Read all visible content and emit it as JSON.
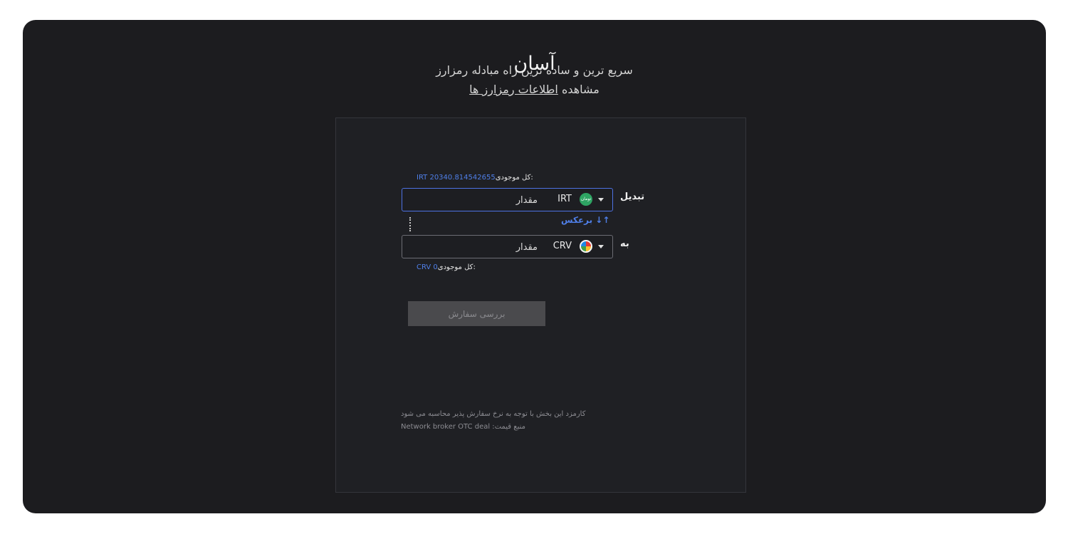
{
  "header": {
    "title": "آسان",
    "subtitle": "سریع ترین و ساده ترین راه مبادله رمزارز",
    "view_text": "مشاهده",
    "view_link": "اطلاعات رمزارز ها"
  },
  "from": {
    "balance_label": "کل موجودی:",
    "balance_value": "IRT 20340.814542655",
    "label": "تبدیل",
    "coin_code": "IRT",
    "coin_logo_text": "تومان",
    "amount_placeholder": "مقدار",
    "coin_logo_color": "#2ea463"
  },
  "reverse_label": "↑↓ برعکس",
  "to": {
    "label": "به",
    "coin_code": "CRV",
    "amount_placeholder": "مقدار",
    "balance_label": "کل موجودی:",
    "balance_value": "CRV 0"
  },
  "review_button": "بررسی سفارش",
  "notes": {
    "fee": "کارمزد این بخش با توجه به نرخ سفارش پذیر محاسبه می شود",
    "source": "Network broker OTC deal :منبع قیمت"
  },
  "colors": {
    "background": "#1c1c1f",
    "panel": "#1f2024",
    "accent": "#4f7fe8",
    "active_border": "#4d72e3"
  }
}
